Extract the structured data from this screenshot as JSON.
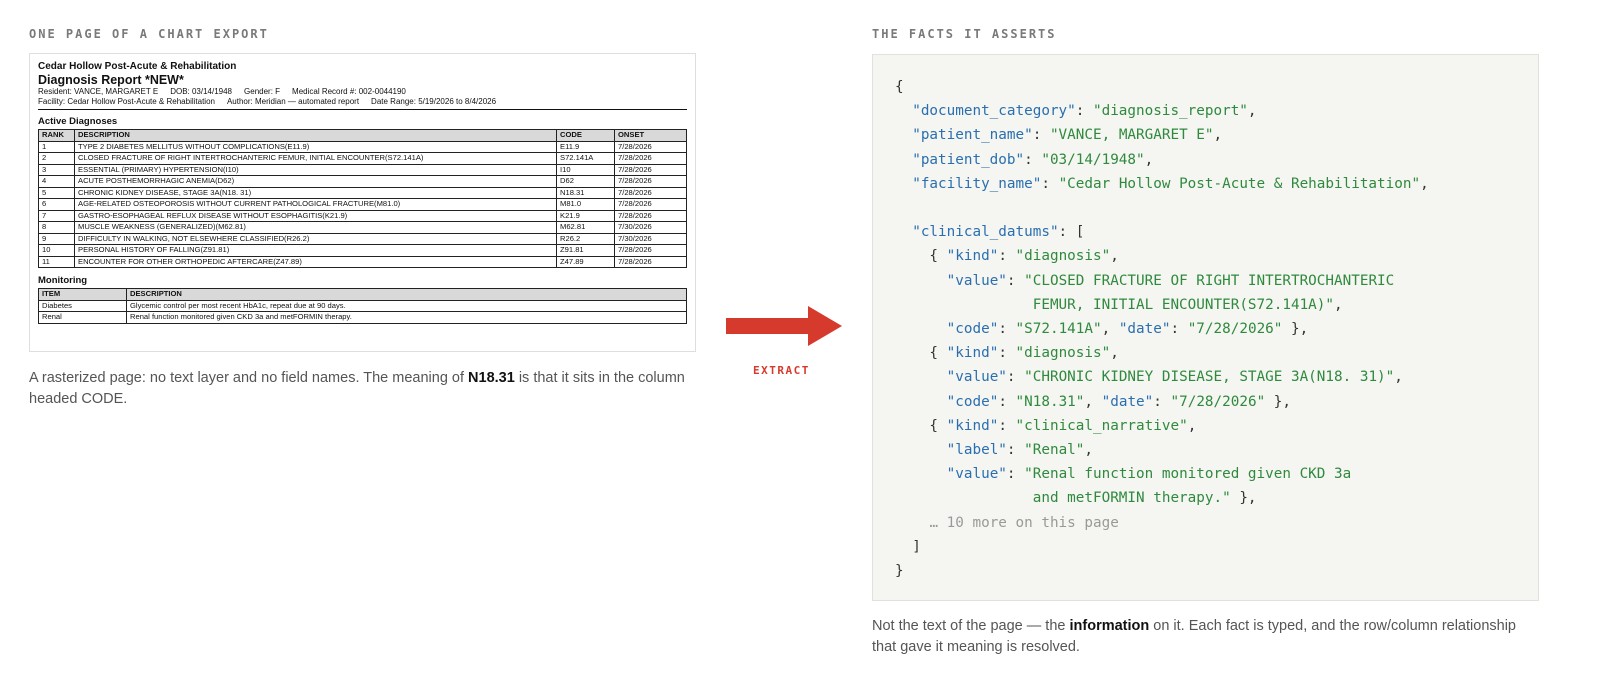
{
  "left": {
    "section_label": "ONE PAGE OF A CHART EXPORT",
    "page": {
      "facility_header": "Cedar Hollow Post-Acute & Rehabilitation",
      "report_title": "Diagnosis Report *NEW*",
      "meta_line1": [
        "Resident: VANCE, MARGARET E",
        "DOB: 03/14/1948",
        "Gender: F",
        "Medical Record #: 002-0044190"
      ],
      "meta_line2": [
        "Facility: Cedar Hollow Post-Acute & Rehabilitation",
        "Author: Meridian — automated report",
        "Date Range: 5/19/2026 to 8/4/2026"
      ],
      "active_diagnoses": {
        "title": "Active Diagnoses",
        "columns": [
          "RANK",
          "DESCRIPTION",
          "CODE",
          "ONSET"
        ],
        "rows": [
          [
            "1",
            "TYPE 2 DIABETES MELLITUS WITHOUT COMPLICATIONS(E11.9)",
            "E11.9",
            "7/28/2026"
          ],
          [
            "2",
            "CLOSED FRACTURE OF RIGHT INTERTROCHANTERIC FEMUR, INITIAL ENCOUNTER(S72.141A)",
            "S72.141A",
            "7/28/2026"
          ],
          [
            "3",
            "ESSENTIAL (PRIMARY) HYPERTENSION(I10)",
            "I10",
            "7/28/2026"
          ],
          [
            "4",
            "ACUTE POSTHEMORRHAGIC ANEMIA(D62)",
            "D62",
            "7/28/2026"
          ],
          [
            "5",
            "CHRONIC KIDNEY DISEASE, STAGE 3A(N18. 31)",
            "N18.31",
            "7/28/2026"
          ],
          [
            "6",
            "AGE-RELATED OSTEOPOROSIS WITHOUT CURRENT PATHOLOGICAL FRACTURE(M81.0)",
            "M81.0",
            "7/28/2026"
          ],
          [
            "7",
            "GASTRO-ESOPHAGEAL REFLUX DISEASE WITHOUT ESOPHAGITIS(K21.9)",
            "K21.9",
            "7/28/2026"
          ],
          [
            "8",
            "MUSCLE WEAKNESS (GENERALIZED)(M62.81)",
            "M62.81",
            "7/30/2026"
          ],
          [
            "9",
            "DIFFICULTY IN WALKING, NOT ELSEWHERE CLASSIFIED(R26.2)",
            "R26.2",
            "7/30/2026"
          ],
          [
            "10",
            "PERSONAL HISTORY OF FALLING(Z91.81)",
            "Z91.81",
            "7/28/2026"
          ],
          [
            "11",
            "ENCOUNTER FOR OTHER ORTHOPEDIC AFTERCARE(Z47.89)",
            "Z47.89",
            "7/28/2026"
          ]
        ]
      },
      "monitoring": {
        "title": "Monitoring",
        "columns": [
          "ITEM",
          "DESCRIPTION"
        ],
        "rows": [
          [
            "Diabetes",
            "Glycemic control per most recent HbA1c, repeat due at 90 days."
          ],
          [
            "Renal",
            "Renal function monitored given CKD 3a and metFORMIN therapy."
          ]
        ]
      }
    },
    "caption_prefix": "A rasterized page: no text layer and no field names. The meaning of ",
    "caption_bold": "N18.31",
    "caption_suffix": " is that it sits in the column headed CODE."
  },
  "arrow": {
    "label": "EXTRACT",
    "color": "#d63a2c"
  },
  "right": {
    "section_label": "THE FACTS IT ASSERTS",
    "json_lines": [
      [
        [
          "p",
          "{"
        ]
      ],
      [
        [
          "p",
          "  "
        ],
        [
          "k",
          "\"document_category\""
        ],
        [
          "p",
          ": "
        ],
        [
          "s",
          "\"diagnosis_report\""
        ],
        [
          "p",
          ","
        ]
      ],
      [
        [
          "p",
          "  "
        ],
        [
          "k",
          "\"patient_name\""
        ],
        [
          "p",
          ": "
        ],
        [
          "s",
          "\"VANCE, MARGARET E\""
        ],
        [
          "p",
          ","
        ]
      ],
      [
        [
          "p",
          "  "
        ],
        [
          "k",
          "\"patient_dob\""
        ],
        [
          "p",
          ": "
        ],
        [
          "s",
          "\"03/14/1948\""
        ],
        [
          "p",
          ","
        ]
      ],
      [
        [
          "p",
          "  "
        ],
        [
          "k",
          "\"facility_name\""
        ],
        [
          "p",
          ": "
        ],
        [
          "s",
          "\"Cedar Hollow Post-Acute & Rehabilitation\""
        ],
        [
          "p",
          ","
        ]
      ],
      [
        [
          "p",
          ""
        ]
      ],
      [
        [
          "p",
          "  "
        ],
        [
          "k",
          "\"clinical_datums\""
        ],
        [
          "p",
          ": ["
        ]
      ],
      [
        [
          "p",
          "    { "
        ],
        [
          "k",
          "\"kind\""
        ],
        [
          "p",
          ": "
        ],
        [
          "s",
          "\"diagnosis\""
        ],
        [
          "p",
          ","
        ]
      ],
      [
        [
          "p",
          "      "
        ],
        [
          "k",
          "\"value\""
        ],
        [
          "p",
          ": "
        ],
        [
          "s",
          "\"CLOSED FRACTURE OF RIGHT INTERTROCHANTERIC"
        ]
      ],
      [
        [
          "p",
          "                "
        ],
        [
          "s",
          "FEMUR, INITIAL ENCOUNTER(S72.141A)\""
        ],
        [
          "p",
          ","
        ]
      ],
      [
        [
          "p",
          "      "
        ],
        [
          "k",
          "\"code\""
        ],
        [
          "p",
          ": "
        ],
        [
          "s",
          "\"S72.141A\""
        ],
        [
          "p",
          ", "
        ],
        [
          "k",
          "\"date\""
        ],
        [
          "p",
          ": "
        ],
        [
          "s",
          "\"7/28/2026\""
        ],
        [
          "p",
          " },"
        ]
      ],
      [
        [
          "p",
          "    { "
        ],
        [
          "k",
          "\"kind\""
        ],
        [
          "p",
          ": "
        ],
        [
          "s",
          "\"diagnosis\""
        ],
        [
          "p",
          ","
        ]
      ],
      [
        [
          "p",
          "      "
        ],
        [
          "k",
          "\"value\""
        ],
        [
          "p",
          ": "
        ],
        [
          "s",
          "\"CHRONIC KIDNEY DISEASE, STAGE 3A(N18. 31)\""
        ],
        [
          "p",
          ","
        ]
      ],
      [
        [
          "p",
          "      "
        ],
        [
          "k",
          "\"code\""
        ],
        [
          "p",
          ": "
        ],
        [
          "s",
          "\"N18.31\""
        ],
        [
          "p",
          ", "
        ],
        [
          "k",
          "\"date\""
        ],
        [
          "p",
          ": "
        ],
        [
          "s",
          "\"7/28/2026\""
        ],
        [
          "p",
          " },"
        ]
      ],
      [
        [
          "p",
          "    { "
        ],
        [
          "k",
          "\"kind\""
        ],
        [
          "p",
          ": "
        ],
        [
          "s",
          "\"clinical_narrative\""
        ],
        [
          "p",
          ","
        ]
      ],
      [
        [
          "p",
          "      "
        ],
        [
          "k",
          "\"label\""
        ],
        [
          "p",
          ": "
        ],
        [
          "s",
          "\"Renal\""
        ],
        [
          "p",
          ","
        ]
      ],
      [
        [
          "p",
          "      "
        ],
        [
          "k",
          "\"value\""
        ],
        [
          "p",
          ": "
        ],
        [
          "s",
          "\"Renal function monitored given CKD 3a"
        ]
      ],
      [
        [
          "p",
          "                "
        ],
        [
          "s",
          "and metFORMIN therapy.\""
        ],
        [
          "p",
          " },"
        ]
      ],
      [
        [
          "p",
          "    "
        ],
        [
          "m",
          "… 10 more on this page"
        ]
      ],
      [
        [
          "p",
          "  ]"
        ]
      ],
      [
        [
          "p",
          "}"
        ]
      ]
    ],
    "caption_prefix": "Not the text of the page — the ",
    "caption_bold": "information",
    "caption_suffix": " on it. Each fact is typed, and the row/column relationship that gave it meaning is resolved."
  }
}
